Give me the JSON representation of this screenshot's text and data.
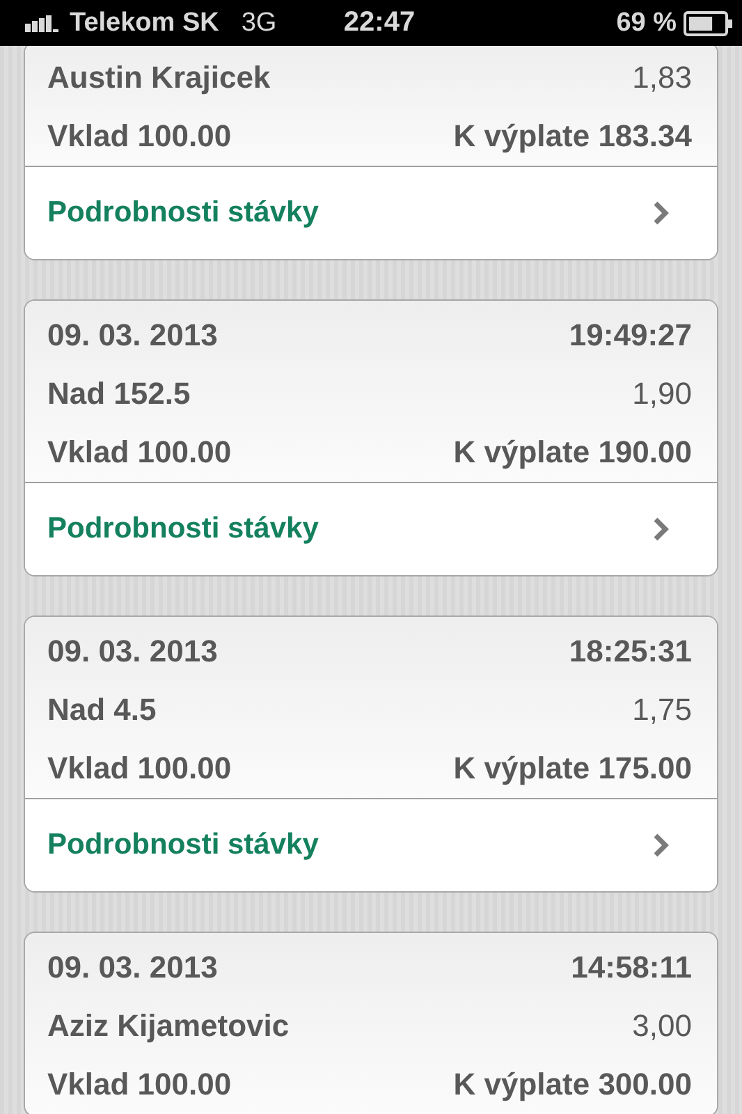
{
  "status_bar": {
    "carrier": "Telekom SK",
    "network": "3G",
    "time": "22:47",
    "battery": "69 %"
  },
  "bets": [
    {
      "selection": "Austin Krajicek",
      "odds": "1,83",
      "stake": "Vklad 100.00",
      "payout": "K výplate 183.34",
      "details": "Podrobnosti stávky"
    },
    {
      "date": "09. 03. 2013",
      "time": "19:49:27",
      "selection": "Nad 152.5",
      "odds": "1,90",
      "stake": "Vklad 100.00",
      "payout": "K výplate 190.00",
      "details": "Podrobnosti stávky"
    },
    {
      "date": "09. 03. 2013",
      "time": "18:25:31",
      "selection": "Nad 4.5",
      "odds": "1,75",
      "stake": "Vklad 100.00",
      "payout": "K výplate 175.00",
      "details": "Podrobnosti stávky"
    },
    {
      "date": "09. 03. 2013",
      "time": "14:58:11",
      "selection": "Aziz Kijametovic",
      "odds": "3,00",
      "stake": "Vklad 100.00",
      "payout": "K výplate 300.00"
    }
  ]
}
